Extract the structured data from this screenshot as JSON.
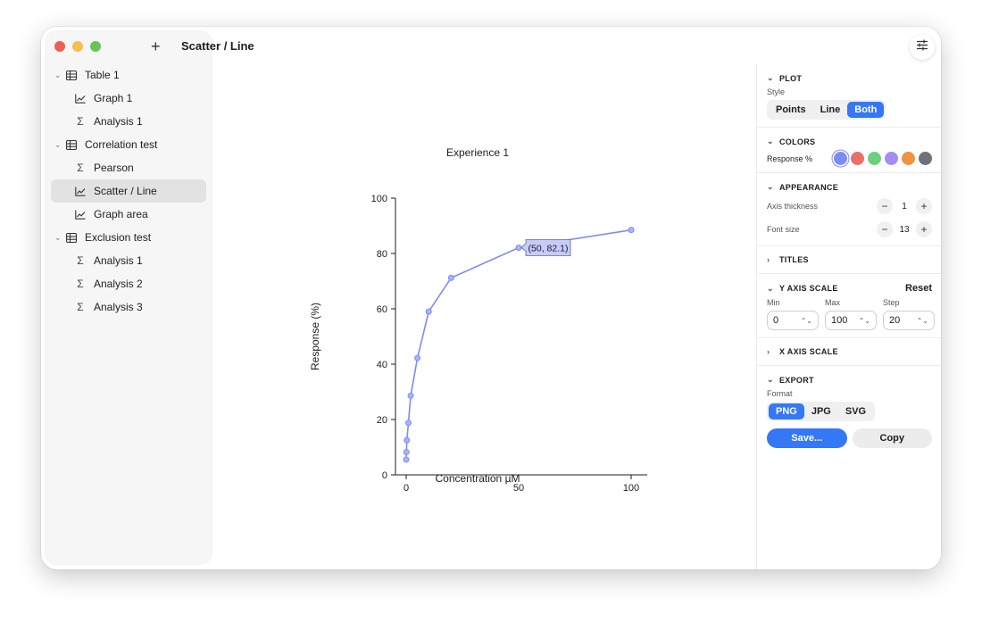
{
  "window": {
    "title": "Scatter / Line"
  },
  "sidebar": {
    "add_label": "+",
    "groups": [
      {
        "label": "Table 1",
        "items": [
          {
            "label": "Graph 1",
            "icon": "chart-icon"
          },
          {
            "label": "Analysis 1",
            "icon": "sigma-icon"
          }
        ]
      },
      {
        "label": "Correlation test",
        "items": [
          {
            "label": "Pearson",
            "icon": "sigma-icon"
          },
          {
            "label": "Scatter / Line",
            "icon": "chart-icon",
            "selected": true
          },
          {
            "label": "Graph area",
            "icon": "chart-icon"
          }
        ]
      },
      {
        "label": "Exclusion test",
        "items": [
          {
            "label": "Analysis 1",
            "icon": "sigma-icon"
          },
          {
            "label": "Analysis 2",
            "icon": "sigma-icon"
          },
          {
            "label": "Analysis 3",
            "icon": "sigma-icon"
          }
        ]
      }
    ]
  },
  "chart_data": {
    "type": "line",
    "title": "Experience 1",
    "xlabel": "Concentration µM",
    "ylabel": "Response (%)",
    "x": [
      0,
      0.1,
      0.3,
      1,
      2,
      5,
      10,
      20,
      50,
      100
    ],
    "series": [
      {
        "values": [
          5.5,
          8.2,
          12.5,
          18.8,
          28.6,
          42.2,
          59,
          71.2,
          82.1,
          88.5
        ],
        "color": "#7d8cf5"
      }
    ],
    "xlim": [
      0,
      100
    ],
    "ylim": [
      0,
      100
    ],
    "xticks": [
      0,
      50,
      100
    ],
    "yticks": [
      0,
      20,
      40,
      60,
      80,
      100
    ],
    "grid": false,
    "tooltip": {
      "text": "(50, 82.1)"
    }
  },
  "panel": {
    "plot": {
      "header": "PLOT",
      "style_label": "Style",
      "styles": [
        "Points",
        "Line",
        "Both"
      ],
      "selected": "Both"
    },
    "colors": {
      "header": "COLORS",
      "series_label": "Response %",
      "swatches": [
        "#7d8cf5",
        "#e8706c",
        "#6bd17d",
        "#a58cf2",
        "#f0923e",
        "#6e7179"
      ]
    },
    "appearance": {
      "header": "APPEARANCE",
      "axis_thickness_label": "Axis thickness",
      "axis_thickness": "1",
      "font_size_label": "Font size",
      "font_size": "13",
      "minus": "−",
      "plus": "+"
    },
    "titles": {
      "header": "TITLES"
    },
    "yaxis": {
      "header": "Y AXIS SCALE",
      "reset_label": "Reset",
      "min_label": "Min",
      "min": "0",
      "max_label": "Max",
      "max": "100",
      "step_label": "Step",
      "step": "20"
    },
    "xaxis": {
      "header": "X AXIS SCALE"
    },
    "export": {
      "header": "EXPORT",
      "format_label": "Format",
      "formats": [
        "PNG",
        "JPG",
        "SVG"
      ],
      "selected": "PNG",
      "save_label": "Save...",
      "copy_label": "Copy"
    }
  }
}
